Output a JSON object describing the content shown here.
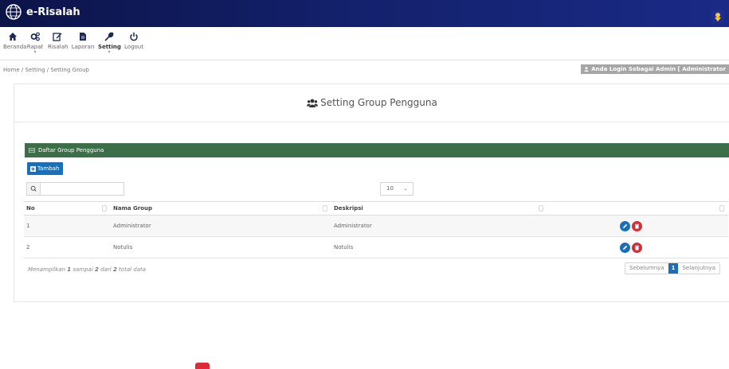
{
  "app": {
    "title": "e-Risalah"
  },
  "toolbar": {
    "items": [
      {
        "label": "Beranda",
        "icon": "home-icon"
      },
      {
        "label": "Rapat",
        "icon": "gears-icon"
      },
      {
        "label": "Risalah",
        "icon": "edit-icon"
      },
      {
        "label": "Laporan",
        "icon": "file-icon"
      },
      {
        "label": "Setting",
        "icon": "wrench-icon",
        "active": true
      },
      {
        "label": "Logout",
        "icon": "power-icon"
      }
    ]
  },
  "breadcrumb": {
    "text": "Home / Setting / Setting Group"
  },
  "login_badge": {
    "text": "Anda Login Sebagai Admin [ Administrator"
  },
  "page": {
    "title": "Setting Group Pengguna"
  },
  "panel": {
    "title": "Daftar Group Pengguna"
  },
  "actions": {
    "add_label": "Tambah"
  },
  "search": {
    "value": "",
    "placeholder": ""
  },
  "length": {
    "value": "10"
  },
  "table": {
    "columns": [
      "No",
      "Nama Group",
      "Deskripsi",
      ""
    ],
    "rows": [
      {
        "no": "1",
        "nama": "Administrator",
        "deskripsi": "Administrator"
      },
      {
        "no": "2",
        "nama": "Notulis",
        "deskripsi": "Notulis"
      }
    ]
  },
  "info": {
    "prefix": "Menampilkan",
    "start": "1",
    "mid1": "sampai",
    "end": "2",
    "mid2": "dari",
    "total": "2",
    "suffix": "total data"
  },
  "pagination": {
    "prev": "Sebelumnya",
    "current": "1",
    "next": "Selanjutnya"
  },
  "colors": {
    "topbar": "#13206a",
    "panel_header": "#3c6e48",
    "primary": "#1a6fb8",
    "danger": "#d0303a"
  }
}
